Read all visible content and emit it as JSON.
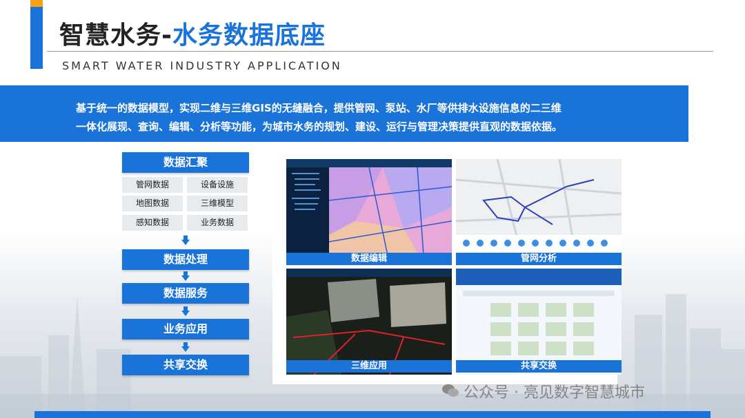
{
  "header": {
    "title_main": "智慧水务-",
    "title_highlight": "水务数据底座",
    "subtitle": "SMART WATER INDUSTRY APPLICATION"
  },
  "banner": {
    "line1": "基于统一的数据模型，实现二维与三维GIS的无缝融合，提供管网、泵站、水厂等供排水设施信息的二三维",
    "line2": "一体化展现、查询、编辑、分析等功能，为城市水务的规划、建设、运行与管理决策提供直观的数据依据。"
  },
  "flow": {
    "step1": "数据汇聚",
    "chips": [
      "管网数据",
      "设备设施",
      "地图数据",
      "三维模型",
      "感知数据",
      "业务数据"
    ],
    "step2": "数据处理",
    "step3": "数据服务",
    "step4": "业务应用",
    "step5": "共享交换"
  },
  "gallery": {
    "tiles": [
      "数据编辑",
      "管网分析",
      "三维应用",
      "共享交换"
    ]
  },
  "watermark": "公众号 · 亮见数字智慧城市",
  "colors": {
    "accent": "#1a73d9",
    "orange": "#f4a21a"
  }
}
